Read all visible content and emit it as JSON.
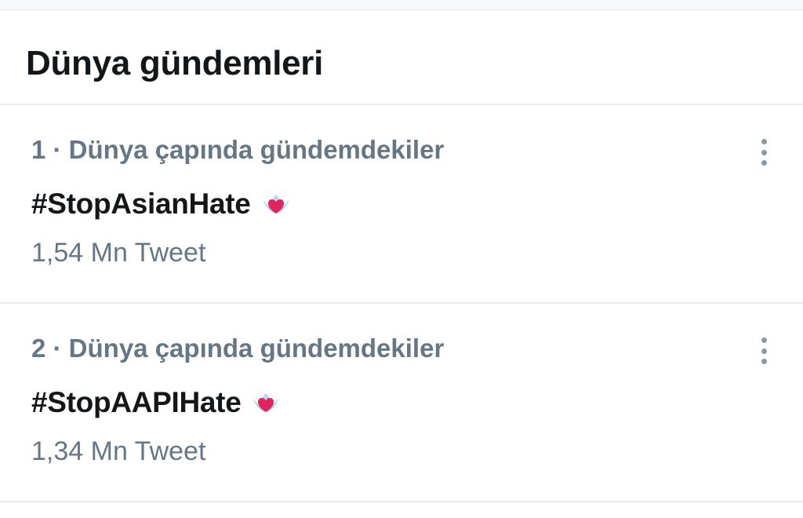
{
  "section": {
    "title": "Dünya gündemleri"
  },
  "trends": [
    {
      "context": "1 · Dünya çapında gündemdekiler",
      "name": "#StopAsianHate",
      "tweet_count": "1,54 Mn Tweet",
      "icon": "lotus-heart-icon"
    },
    {
      "context": "2 · Dünya çapında gündemdekiler",
      "name": "#StopAAPIHate",
      "tweet_count": "1,34 Mn Tweet",
      "icon": "lotus-heart-icon"
    }
  ],
  "colors": {
    "primary_text": "#14171a",
    "secondary_text": "#657786",
    "divider": "#e6ecf0",
    "icon_heart": "#e0245e",
    "icon_petals": "#9fc8f0"
  }
}
